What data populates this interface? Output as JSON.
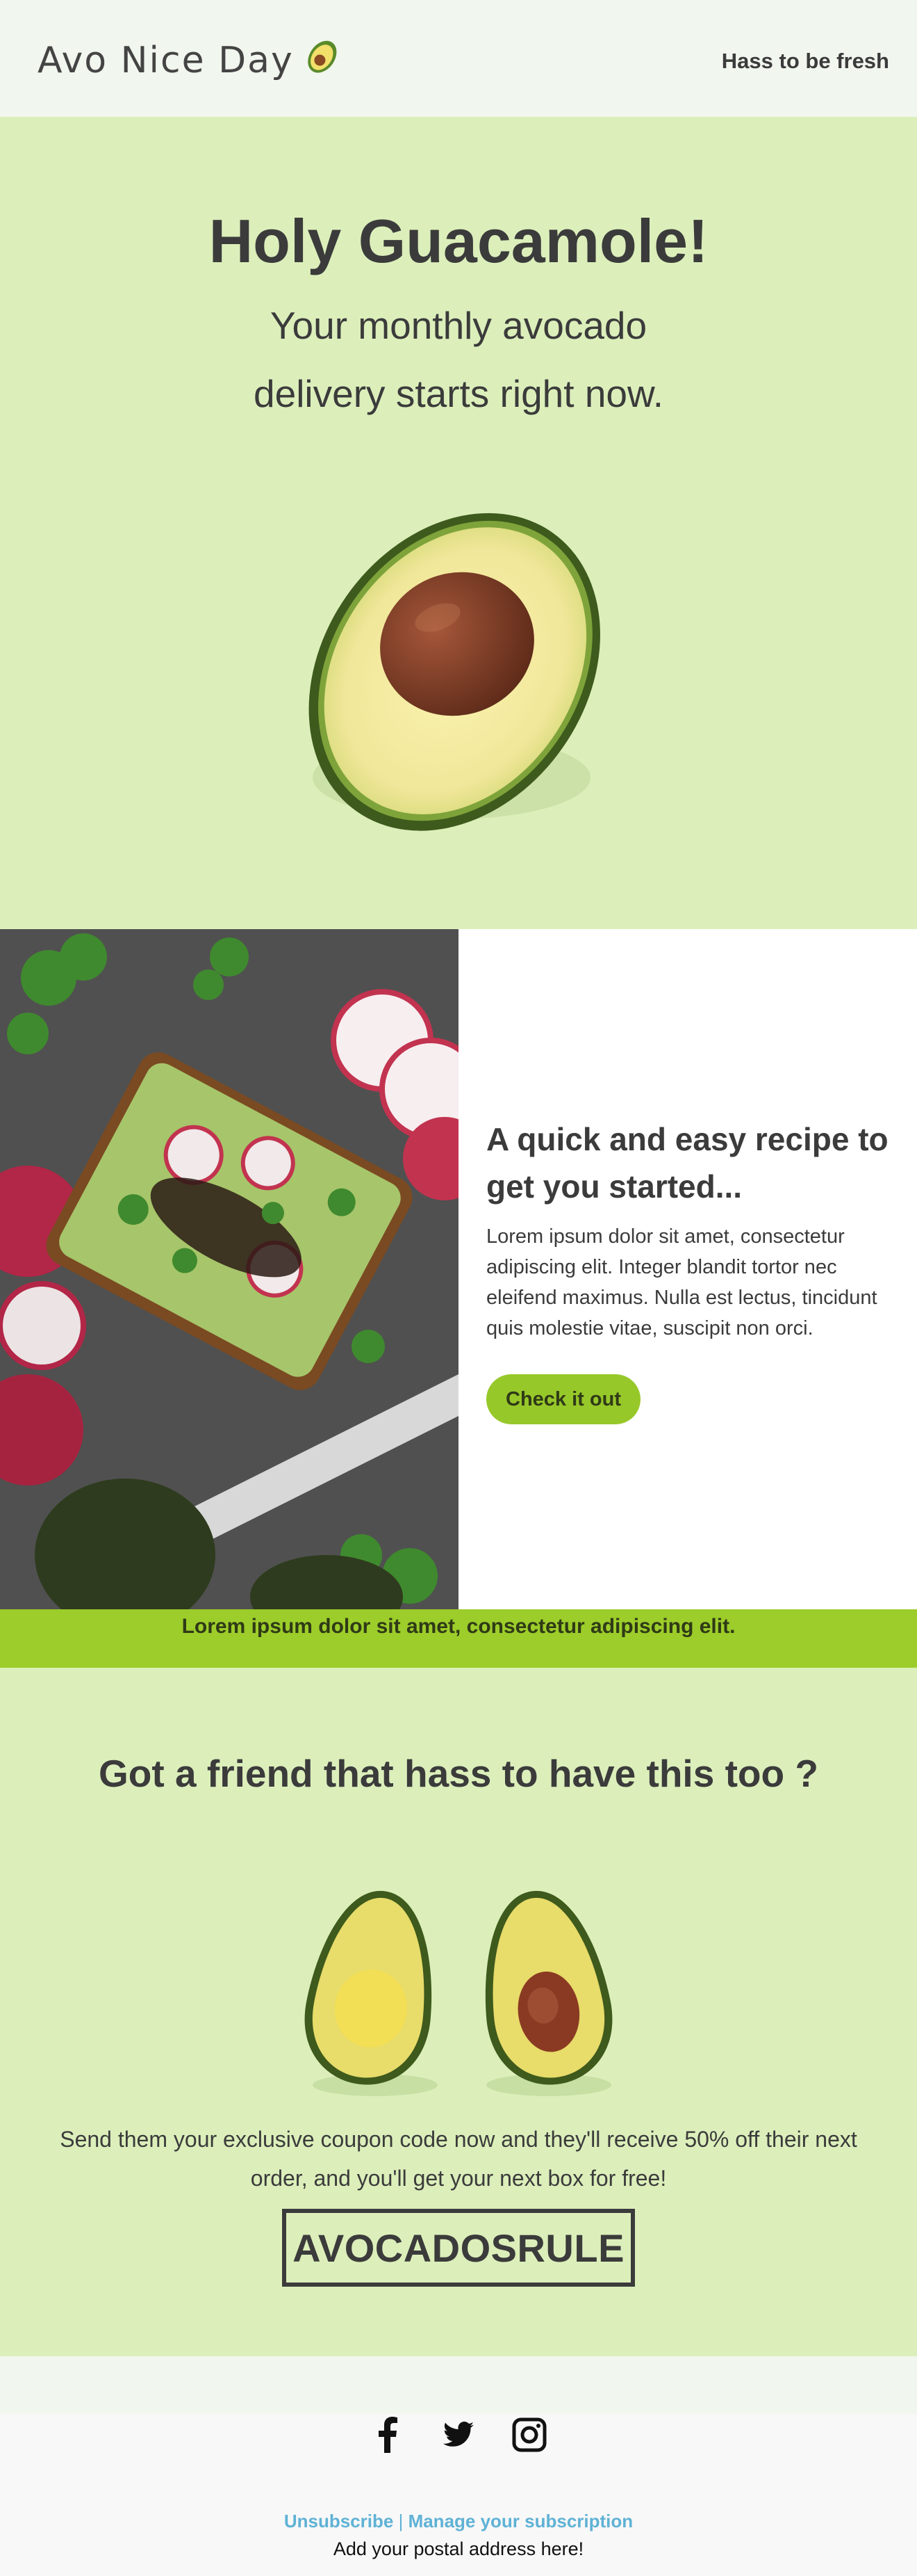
{
  "header": {
    "logo_text": "Avo Nice Day",
    "tagline": "Hass to be fresh"
  },
  "hero": {
    "title": "Holy Guacamole!",
    "subtitle_line1": "Your monthly avocado",
    "subtitle_line2": "delivery starts right now."
  },
  "recipe": {
    "title": "A quick and easy recipe to get you started...",
    "body": "Lorem ipsum dolor sit amet, consectetur adipiscing elit. Integer blandit tortor nec eleifend maximus. Nulla est lectus, tincidunt quis molestie vitae, suscipit non orci.",
    "button_label": "Check it out"
  },
  "banner": {
    "text": "Lorem ipsum dolor sit amet, consectetur adipiscing elit."
  },
  "friend": {
    "title": "Got a friend that hass to have this too ?",
    "body": "Send them your exclusive coupon code now and they'll receive 50% off their next order, and you'll get your next box for free!",
    "coupon_code": "AVOCADOSRULE"
  },
  "footer": {
    "socials": [
      "facebook-icon",
      "twitter-icon",
      "instagram-icon"
    ],
    "unsubscribe_label": "Unsubscribe",
    "separator": "|",
    "manage_label": "Manage your subscription",
    "address": "Add your postal address here!"
  },
  "colors": {
    "header_bg": "#f1f6ee",
    "section_green": "#dcefbb",
    "accent_green": "#9ccd2a",
    "text_dark": "#3b3b3b",
    "link_blue": "#5fb2d5"
  }
}
